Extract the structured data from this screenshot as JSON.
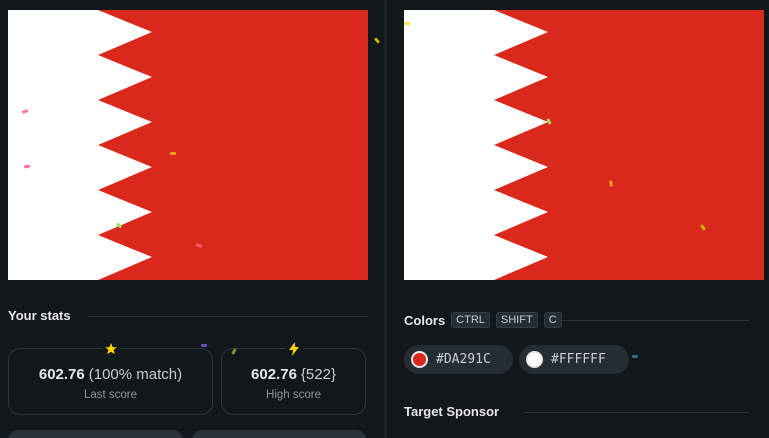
{
  "left_panel": {
    "flag": {
      "name": "Bahrain",
      "white": "#FFFFFF",
      "red": "#DA291C"
    },
    "stats": {
      "title": "Your stats",
      "last_score": {
        "value": "602.76",
        "detail": "(100% match)",
        "label": "Last score",
        "icon": "star-icon",
        "icon_color": "#FFD400"
      },
      "high_score": {
        "value": "602.76",
        "detail": "{522}",
        "label": "High score",
        "icon": "lightning-icon",
        "icon_color": "#FFD400"
      }
    }
  },
  "right_panel": {
    "flag": {
      "name": "Bahrain",
      "white": "#FFFFFF",
      "red": "#DA291C"
    },
    "colors": {
      "title": "Colors",
      "shortcut_keys": [
        "CTRL",
        "SHIFT",
        "C"
      ],
      "swatches": [
        {
          "hex": "#DA291C",
          "color": "#DA291C"
        },
        {
          "hex": "#FFFFFF",
          "color": "#FFFFFF"
        }
      ]
    },
    "sponsor": {
      "title": "Target Sponsor"
    }
  }
}
